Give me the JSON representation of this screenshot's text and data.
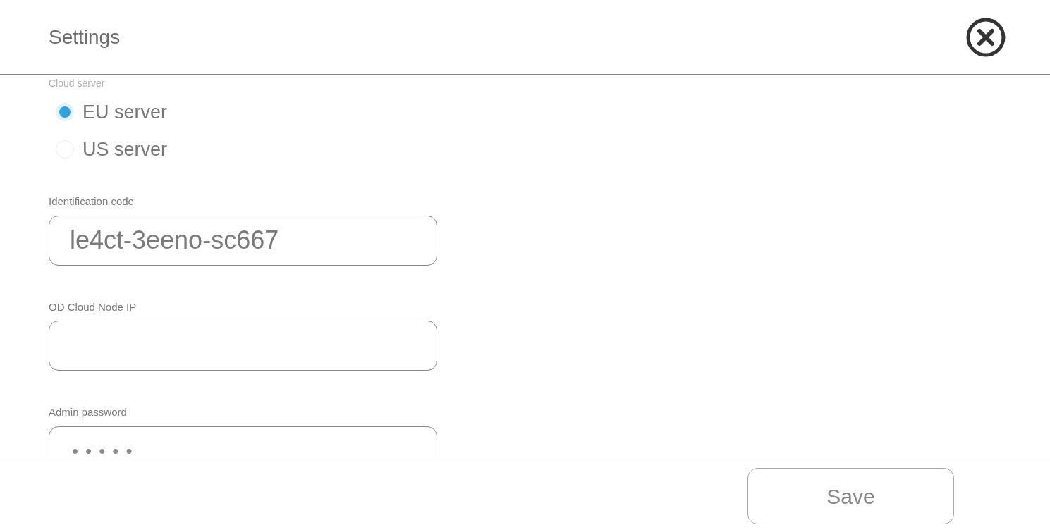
{
  "window": {
    "title": "Settings"
  },
  "cloud_server": {
    "label": "Cloud server",
    "options": [
      {
        "label": "EU server",
        "selected": true
      },
      {
        "label": "US server",
        "selected": false
      }
    ]
  },
  "fields": [
    {
      "kind": "text",
      "label": "Identification code",
      "value": "le4ct-3eeno-sc667"
    },
    {
      "kind": "text",
      "label": "OD Cloud Node IP"
    },
    {
      "kind": "password",
      "label": "Admin password",
      "value": "•••••"
    }
  ],
  "buttons": [
    "Save"
  ]
}
